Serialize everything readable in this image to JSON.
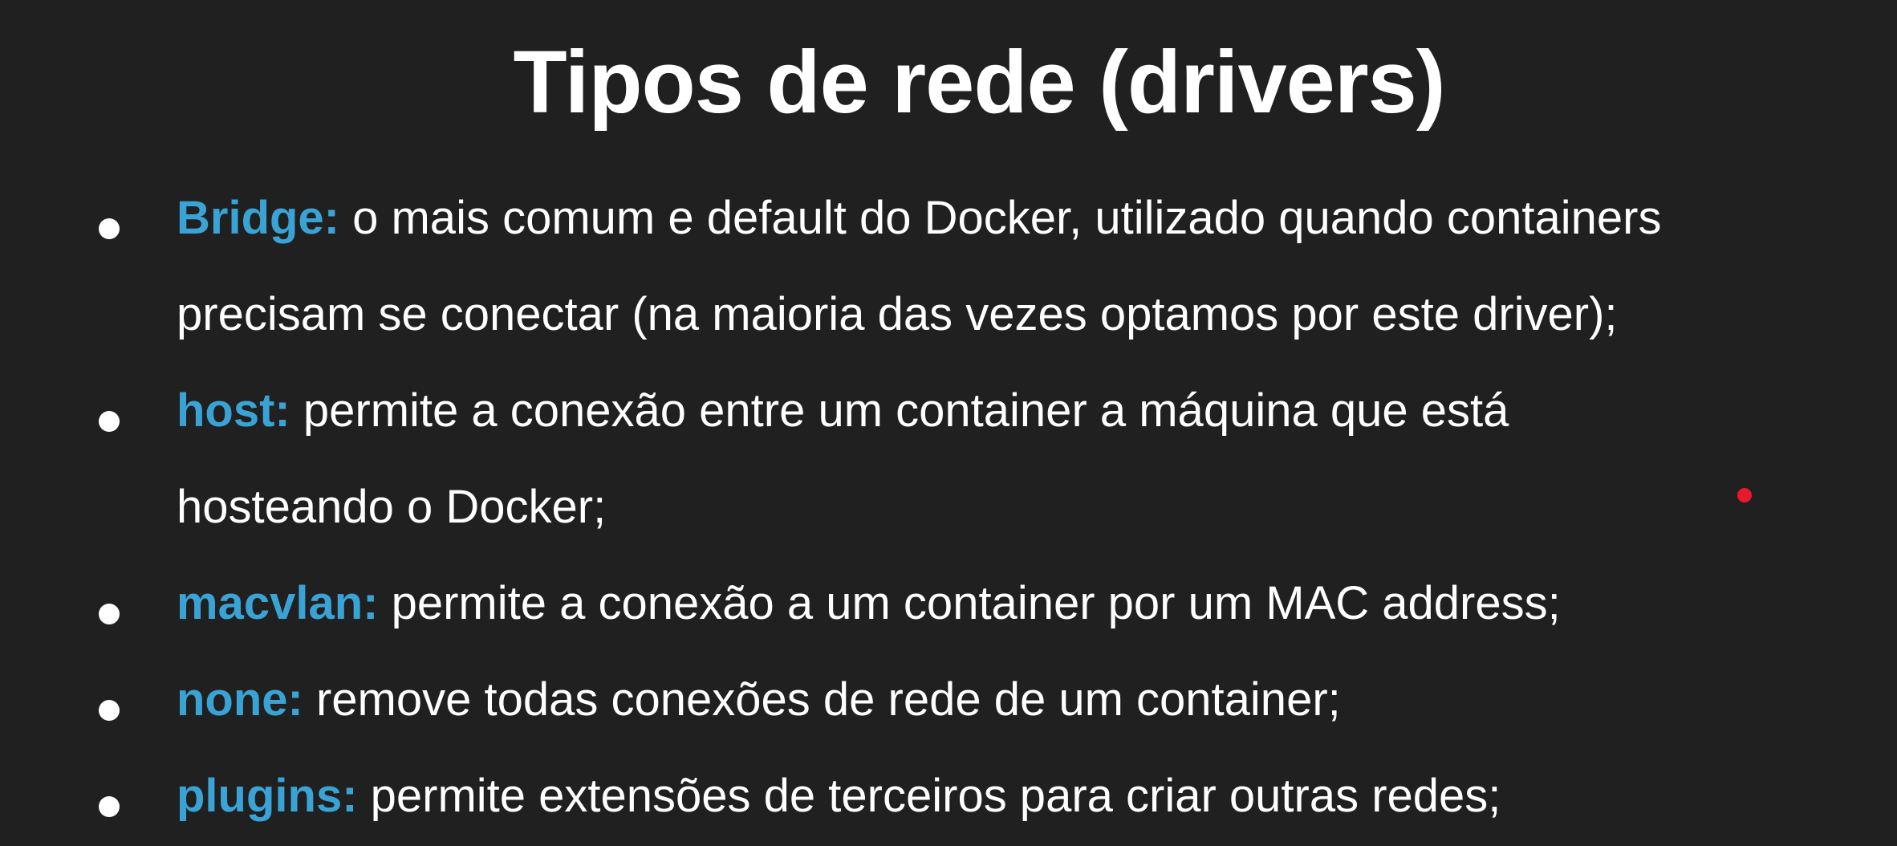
{
  "title": "Tipos de rede (drivers)",
  "items": [
    {
      "term": "Bridge:",
      "line1": "o mais comum e default do Docker, utilizado quando containers",
      "line2": "precisam se conectar (na maioria das vezes optamos por este driver);"
    },
    {
      "term": "host:",
      "line1": "permite a conexão entre um container a máquina que está",
      "line2": "hosteando o Docker;"
    },
    {
      "term": "macvlan:",
      "line1": "permite a conexão a um container por um MAC address;"
    },
    {
      "term": "none:",
      "line1": "remove todas conexões de rede de um container;"
    },
    {
      "term": "plugins:",
      "line1": "permite extensões de terceiros para criar outras redes;"
    }
  ],
  "colors": {
    "background": "#202020",
    "text": "#ffffff",
    "accent": "#3aa3d6",
    "pointer": "#e8192c"
  }
}
